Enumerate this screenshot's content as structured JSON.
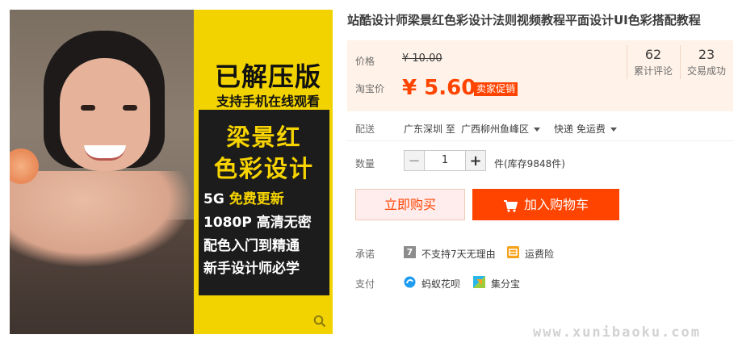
{
  "product_image": {
    "line1": "已解压版",
    "line2": "支持手机在线观看",
    "yellow1": "梁景红",
    "yellow2": "色彩设计",
    "feature1_a": "5G ",
    "feature1_b": "免费更新",
    "feature2": "1080P 高清无密",
    "feature3": "配色入门到精通",
    "feature4": "新手设计师必学",
    "background_color": "#f2d300"
  },
  "product": {
    "title": "站酷设计师梁景红色彩设计法则视频教程平面设计UI色彩搭配教程"
  },
  "price": {
    "orig_label": "价格",
    "orig_value": "¥ 10.00",
    "sale_label": "淘宝价",
    "sale_value": "¥ 5.60",
    "promo_badge": "卖家促销",
    "accent_color": "#ff4400"
  },
  "stats": {
    "reviews_count": "62",
    "reviews_label": "累计评论",
    "deals_count": "23",
    "deals_label": "交易成功"
  },
  "shipping": {
    "label": "配送",
    "from": "广东深圳 至",
    "to": "广西柳州鱼峰区",
    "method": "快递 免运费"
  },
  "quantity": {
    "label": "数量",
    "value": "1",
    "minus": "−",
    "plus": "+",
    "stock": "件(库存9848件)"
  },
  "actions": {
    "buy_now": "立即购买",
    "add_to_cart": "加入购物车"
  },
  "promise": {
    "label": "承诺",
    "item1": "不支持7天无理由",
    "item1_icon_text": "7",
    "item2": "运费险"
  },
  "payment": {
    "label": "支付",
    "method1": "蚂蚁花呗",
    "method2": "集分宝"
  },
  "watermark": "www.xunibaoku.com"
}
